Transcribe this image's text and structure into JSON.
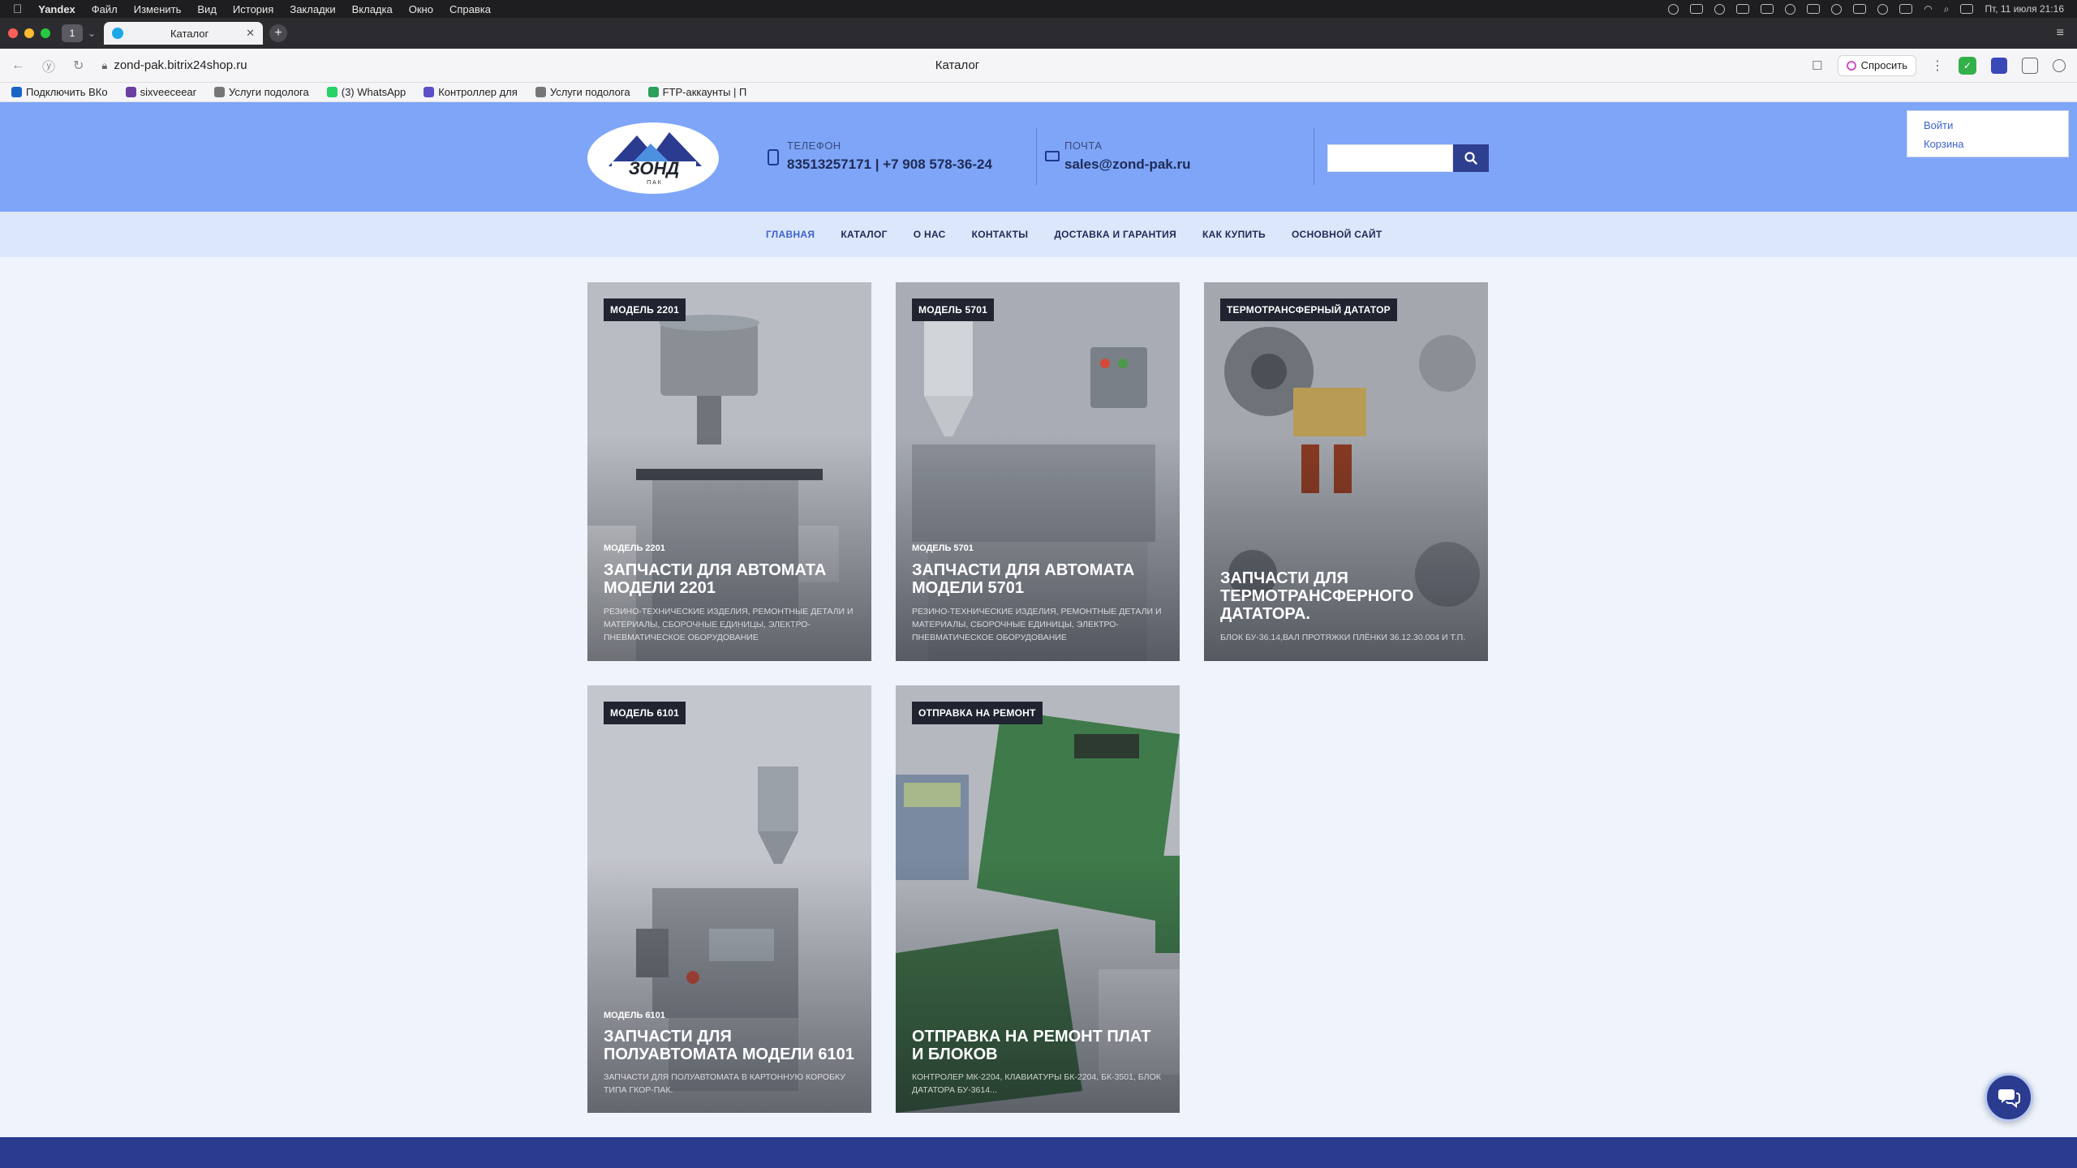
{
  "menubar": {
    "app": "Yandex",
    "items": [
      "Файл",
      "Изменить",
      "Вид",
      "История",
      "Закладки",
      "Вкладка",
      "Окно",
      "Справка"
    ],
    "datetime": "Пт, 11 июля  21:16"
  },
  "browser": {
    "tab_count": "1",
    "tab_title": "Каталог",
    "url": "zond-pak.bitrix24shop.ru",
    "page_title": "Каталог",
    "ask_label": "Спросить"
  },
  "bookmarks": [
    {
      "label": "Подключить ВКо",
      "color": "#1a64c8"
    },
    {
      "label": "sixveeceear",
      "color": "#6b3fa0"
    },
    {
      "label": "Услуги подолога",
      "color": "#777777"
    },
    {
      "label": "(3) WhatsApp",
      "color": "#25d366"
    },
    {
      "label": "Контроллер для",
      "color": "#5b4fc8"
    },
    {
      "label": "Услуги подолога",
      "color": "#777777"
    },
    {
      "label": "FTP-аккаунты | П",
      "color": "#2aa05a"
    }
  ],
  "header": {
    "phone_label": "ТЕЛЕФОН",
    "phone_value": "83513257171 | +7 908 578-36-24",
    "email_label": "ПОЧТА",
    "email_value": "sales@zond-pak.ru",
    "login": "Войти",
    "cart": "Корзина",
    "logo_text": "ЗОНД",
    "logo_sub": "П А К"
  },
  "nav": [
    {
      "label": "ГЛАВНАЯ",
      "active": true
    },
    {
      "label": "КАТАЛОГ",
      "active": false
    },
    {
      "label": "О НАС",
      "active": false
    },
    {
      "label": "КОНТАКТЫ",
      "active": false
    },
    {
      "label": "ДОСТАВКА И ГАРАНТИЯ",
      "active": false
    },
    {
      "label": "КАК КУПИТЬ",
      "active": false
    },
    {
      "label": "ОСНОВНОЙ САЙТ",
      "active": false
    }
  ],
  "cards": [
    {
      "badge": "МОДЕЛЬ 2201",
      "small": "МОДЕЛЬ 2201",
      "title": "ЗАПЧАСТИ ДЛЯ АВТОМАТА МОДЕЛИ 2201",
      "desc": "РЕЗИНО-ТЕХНИЧЕСКИЕ ИЗДЕЛИЯ, РЕМОНТНЫЕ ДЕТАЛИ И МАТЕРИАЛЫ, СБОРОЧНЫЕ ЕДИНИЦЫ, ЭЛЕКТРО-ПНЕВМАТИЧЕСКОЕ ОБОРУДОВАНИЕ"
    },
    {
      "badge": "МОДЕЛЬ 5701",
      "small": "МОДЕЛЬ 5701",
      "title": "ЗАПЧАСТИ ДЛЯ АВТОМАТА МОДЕЛИ 5701",
      "desc": "РЕЗИНО-ТЕХНИЧЕСКИЕ ИЗДЕЛИЯ, РЕМОНТНЫЕ ДЕТАЛИ И МАТЕРИАЛЫ, СБОРОЧНЫЕ ЕДИНИЦЫ, ЭЛЕКТРО-ПНЕВМАТИЧЕСКОЕ ОБОРУДОВАНИЕ"
    },
    {
      "badge": "ТЕРМОТРАНСФЕРНЫЙ ДАТАТОР",
      "small": "",
      "title": "ЗАПЧАСТИ ДЛЯ ТЕРМОТРАНСФЕРНОГО ДАТАТОРА.",
      "desc": "БЛОК БУ-36.14,ВАЛ ПРОТЯЖКИ ПЛЁНКИ 36.12.30.004 И Т.П."
    },
    {
      "badge": "МОДЕЛЬ 6101",
      "small": "МОДЕЛЬ 6101",
      "title": "ЗАПЧАСТИ ДЛЯ ПОЛУАВТОМАТА МОДЕЛИ 6101",
      "desc": "ЗАПЧАСТИ ДЛЯ ПОЛУАВТОМАТА В КАРТОННУЮ КОРОБКУ ТИПА ГКОР-ПАК."
    },
    {
      "badge": "ОТПРАВКА НА РЕМОНТ",
      "small": "",
      "title": "ОТПРАВКА НА РЕМОНТ ПЛАТ И БЛОКОВ",
      "desc": "КОНТРОЛЕР МК-2204, КЛАВИАТУРЫ БК-2204, БК-3501, БЛОК ДАТАТОРА БУ-3614..."
    }
  ],
  "colors": {
    "header_bg": "#7ea5f8",
    "nav_bg": "#dce7fc",
    "accent": "#2b3b8f",
    "link": "#3d63c9"
  }
}
